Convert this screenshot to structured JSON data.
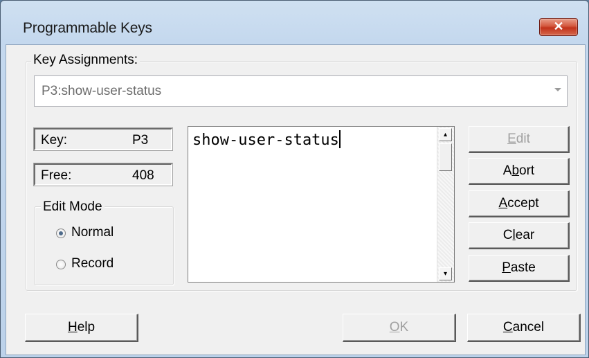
{
  "window": {
    "title": "Programmable Keys",
    "close_glyph": "✕"
  },
  "key_assignments": {
    "label": "Key Assignments:",
    "selected": "P3:show-user-status"
  },
  "info": {
    "key_label": "Key:",
    "key_value": "P3",
    "free_label": "Free:",
    "free_value": "408"
  },
  "edit_mode": {
    "label": "Edit Mode",
    "options": [
      "Normal",
      "Record"
    ],
    "selected": "Normal"
  },
  "editor": {
    "text": "show-user-status"
  },
  "side_buttons": {
    "edit": {
      "before": "",
      "key": "E",
      "after": "dit",
      "enabled": false
    },
    "abort": {
      "before": "A",
      "key": "b",
      "after": "ort",
      "enabled": true
    },
    "accept": {
      "before": "",
      "key": "A",
      "after": "ccept",
      "enabled": true
    },
    "clear": {
      "before": "C",
      "key": "l",
      "after": "ear",
      "enabled": true
    },
    "paste": {
      "before": "",
      "key": "P",
      "after": "aste",
      "enabled": true
    }
  },
  "bottom_buttons": {
    "help": {
      "before": "",
      "key": "H",
      "after": "elp",
      "enabled": true
    },
    "ok": {
      "before": "",
      "key": "O",
      "after": "K",
      "enabled": false
    },
    "cancel": {
      "before": "",
      "key": "C",
      "after": "ancel",
      "enabled": true
    }
  },
  "icons": {
    "combo_arrow": "chevron-down-icon",
    "scroll_up": "scroll-up-icon",
    "scroll_down": "scroll-down-icon",
    "close": "close-icon"
  },
  "colors": {
    "close_button": "#c1321a",
    "disabled_text": "#a0a0a0",
    "dialog_face": "#f0f0f0"
  }
}
